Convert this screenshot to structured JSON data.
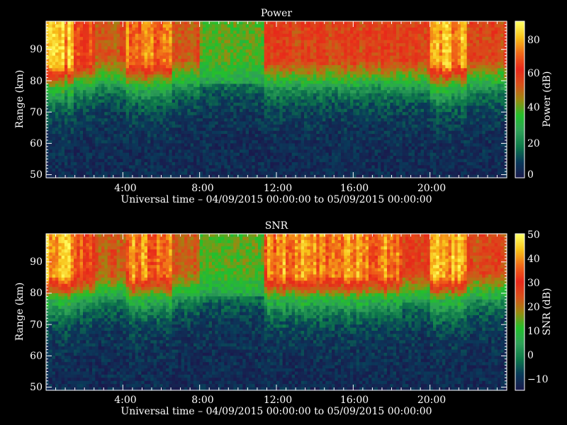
{
  "chart_data": [
    {
      "type": "heatmap",
      "title": "Power",
      "xlabel": "Universal time – 04/09/2015 00:00:00 to 05/09/2015 00:00:00",
      "ylabel": "Range (km)",
      "x_unit": "hours UT",
      "xlim": [
        0,
        24
      ],
      "ylim": [
        49,
        99
      ],
      "xticks": [
        "4:00",
        "8:00",
        "12:00",
        "16:00",
        "20:00"
      ],
      "yticks": [
        "50",
        "60",
        "70",
        "80",
        "90"
      ],
      "colorbar": {
        "label": "Power (dB)",
        "range": [
          0,
          90
        ],
        "ticks": [
          "0",
          "20",
          "40",
          "60",
          "80"
        ]
      },
      "grid": false
    },
    {
      "type": "heatmap",
      "title": "SNR",
      "xlabel": "Universal time – 04/09/2015 00:00:00 to 05/09/2015 00:00:00",
      "ylabel": "Range (km)",
      "x_unit": "hours UT",
      "xlim": [
        0,
        24
      ],
      "ylim": [
        49,
        99
      ],
      "xticks": [
        "4:00",
        "8:00",
        "12:00",
        "16:00",
        "20:00"
      ],
      "yticks": [
        "50",
        "60",
        "70",
        "80",
        "90"
      ],
      "colorbar": {
        "label": "SNR (dB)",
        "range": [
          -15,
          50
        ],
        "ticks": [
          "−10",
          "0",
          "10",
          "20",
          "30",
          "40",
          "50"
        ]
      },
      "grid": false
    }
  ],
  "colormap": [
    "#1a1a4d",
    "#0a3a5a",
    "#0e7a4a",
    "#2fa058",
    "#22c02c",
    "#9a8a10",
    "#d8501a",
    "#e8281a",
    "#f06818",
    "#f8c018",
    "#ffff60"
  ]
}
